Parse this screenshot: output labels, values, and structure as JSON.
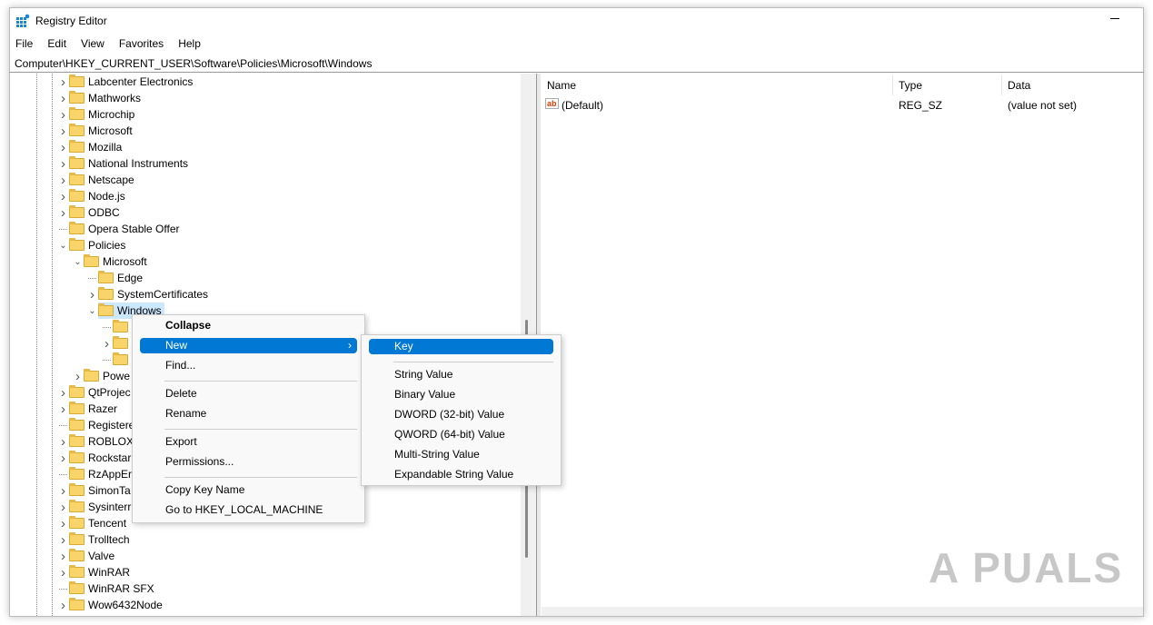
{
  "window": {
    "title": "Registry Editor"
  },
  "menubar": [
    "File",
    "Edit",
    "View",
    "Favorites",
    "Help"
  ],
  "address": "Computer\\HKEY_CURRENT_USER\\Software\\Policies\\Microsoft\\Windows",
  "tree": [
    {
      "label": "Labcenter Electronics",
      "level": 0,
      "chevron": "right"
    },
    {
      "label": "Mathworks",
      "level": 0,
      "chevron": "right"
    },
    {
      "label": "Microchip",
      "level": 0,
      "chevron": "right"
    },
    {
      "label": "Microsoft",
      "level": 0,
      "chevron": "right"
    },
    {
      "label": "Mozilla",
      "level": 0,
      "chevron": "right"
    },
    {
      "label": "National Instruments",
      "level": 0,
      "chevron": "right"
    },
    {
      "label": "Netscape",
      "level": 0,
      "chevron": "right"
    },
    {
      "label": "Node.js",
      "level": 0,
      "chevron": "right"
    },
    {
      "label": "ODBC",
      "level": 0,
      "chevron": "right"
    },
    {
      "label": "Opera Stable Offer",
      "level": 0,
      "chevron": "none"
    },
    {
      "label": "Policies",
      "level": 0,
      "chevron": "down"
    },
    {
      "label": "Microsoft",
      "level": 1,
      "chevron": "down"
    },
    {
      "label": "Edge",
      "level": 2,
      "chevron": "none"
    },
    {
      "label": "SystemCertificates",
      "level": 2,
      "chevron": "right"
    },
    {
      "label": "Windows",
      "level": 2,
      "chevron": "down",
      "selected": true
    },
    {
      "label": "",
      "level": 3,
      "chevron": "none"
    },
    {
      "label": "",
      "level": 3,
      "chevron": "right"
    },
    {
      "label": "",
      "level": 3,
      "chevron": "none"
    },
    {
      "label": "Powe",
      "level": 1,
      "chevron": "right"
    },
    {
      "label": "QtProjec",
      "level": 0,
      "chevron": "right"
    },
    {
      "label": "Razer",
      "level": 0,
      "chevron": "right"
    },
    {
      "label": "Registere",
      "level": 0,
      "chevron": "none"
    },
    {
      "label": "ROBLOX",
      "level": 0,
      "chevron": "right"
    },
    {
      "label": "Rockstar",
      "level": 0,
      "chevron": "right"
    },
    {
      "label": "RzAppEr",
      "level": 0,
      "chevron": "none"
    },
    {
      "label": "SimonTa",
      "level": 0,
      "chevron": "right"
    },
    {
      "label": "Sysinterr",
      "level": 0,
      "chevron": "right"
    },
    {
      "label": "Tencent",
      "level": 0,
      "chevron": "right"
    },
    {
      "label": "Trolltech",
      "level": 0,
      "chevron": "right"
    },
    {
      "label": "Valve",
      "level": 0,
      "chevron": "right"
    },
    {
      "label": "WinRAR",
      "level": 0,
      "chevron": "right"
    },
    {
      "label": "WinRAR SFX",
      "level": 0,
      "chevron": "none"
    },
    {
      "label": "Wow6432Node",
      "level": 0,
      "chevron": "right"
    }
  ],
  "values": {
    "columns": [
      "Name",
      "Type",
      "Data"
    ],
    "rows": [
      {
        "name": "(Default)",
        "type": "REG_SZ",
        "data": "(value not set)",
        "icon": "string-value-icon"
      }
    ]
  },
  "context_menu": {
    "items": [
      {
        "label": "Collapse",
        "bold": true
      },
      {
        "label": "New",
        "submenu": true,
        "highlighted": true
      },
      {
        "label": "Find..."
      },
      {
        "sep": true
      },
      {
        "label": "Delete"
      },
      {
        "label": "Rename"
      },
      {
        "sep": true
      },
      {
        "label": "Export"
      },
      {
        "label": "Permissions..."
      },
      {
        "sep": true
      },
      {
        "label": "Copy Key Name"
      },
      {
        "label": "Go to HKEY_LOCAL_MACHINE"
      }
    ]
  },
  "submenu": {
    "items": [
      {
        "label": "Key",
        "highlighted": true
      },
      {
        "sep": true
      },
      {
        "label": "String Value"
      },
      {
        "label": "Binary Value"
      },
      {
        "label": "DWORD (32-bit) Value"
      },
      {
        "label": "QWORD (64-bit) Value"
      },
      {
        "label": "Multi-String Value"
      },
      {
        "label": "Expandable String Value"
      }
    ]
  },
  "watermark": "A PUALS",
  "colors": {
    "accent": "#0078d4",
    "selection": "#cce8ff",
    "folder": "#f8d46a"
  }
}
